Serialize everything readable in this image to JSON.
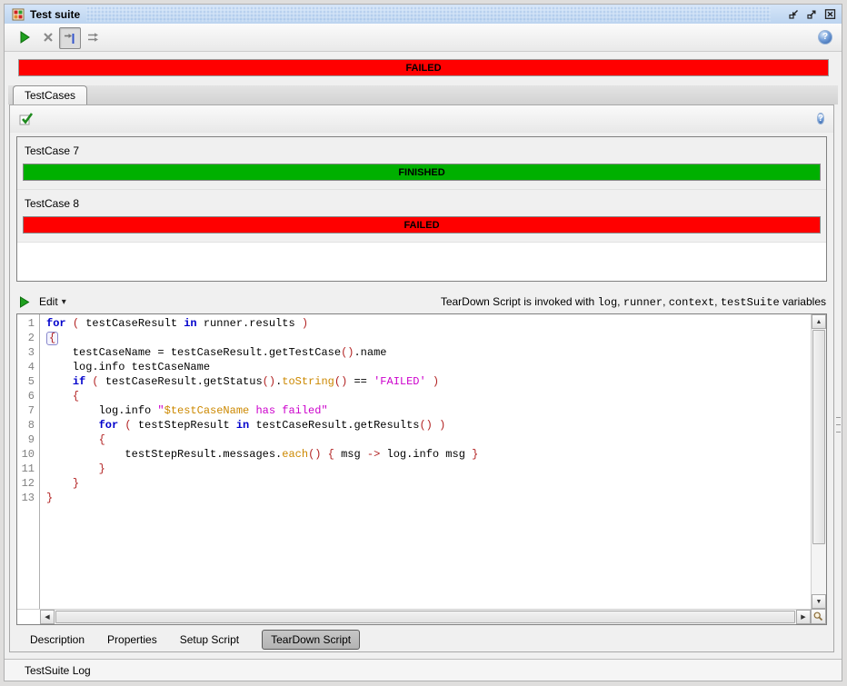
{
  "window": {
    "title": "Test suite"
  },
  "colors": {
    "titlebar": "#c3d9f4",
    "failed": "#ff0000",
    "finished": "#00b000"
  },
  "toolbar": {
    "icons": [
      "run-icon",
      "cancel-icon",
      "run-sequential-toggle-icon",
      "run-options-icon",
      "help-icon"
    ]
  },
  "status": {
    "label": "FAILED",
    "color": "#ff0000"
  },
  "tabs": {
    "label": "TestCases"
  },
  "testcases_toolbar": {
    "icons": [
      "create-testcase-icon",
      "help-icon"
    ]
  },
  "testcases": [
    {
      "name": "TestCase 7",
      "status": "FINISHED",
      "color": "#00b000"
    },
    {
      "name": "TestCase 8",
      "status": "FAILED",
      "color": "#ff0000"
    }
  ],
  "editor_header": {
    "edit_label": "Edit",
    "info_prefix": "TearDown Script is invoked with ",
    "info_vars": [
      "log",
      "runner",
      "context",
      "testSuite"
    ],
    "info_suffix": " variables"
  },
  "code": {
    "lines": [
      {
        "n": 1,
        "toks": [
          [
            "k",
            "for"
          ],
          [
            "d",
            " "
          ],
          [
            "p",
            "("
          ],
          [
            "d",
            " testCaseResult "
          ],
          [
            "k",
            "in"
          ],
          [
            "d",
            " runner.results "
          ],
          [
            "p",
            ")"
          ]
        ]
      },
      {
        "n": 2,
        "toks": [
          [
            "b",
            "{"
          ]
        ]
      },
      {
        "n": 3,
        "toks": [
          [
            "d",
            "    testCaseName = testCaseResult.getTestCase"
          ],
          [
            "p",
            "()"
          ],
          [
            "d",
            ".name"
          ]
        ]
      },
      {
        "n": 4,
        "toks": [
          [
            "d",
            "    log.info testCaseName"
          ]
        ]
      },
      {
        "n": 5,
        "toks": [
          [
            "d",
            "    "
          ],
          [
            "k",
            "if"
          ],
          [
            "d",
            " "
          ],
          [
            "p",
            "("
          ],
          [
            "d",
            " testCaseResult.getStatus"
          ],
          [
            "p",
            "()"
          ],
          [
            "d",
            "."
          ],
          [
            "m",
            "toString"
          ],
          [
            "p",
            "()"
          ],
          [
            "d",
            " == "
          ],
          [
            "s",
            "'FAILED'"
          ],
          [
            "d",
            " "
          ],
          [
            "p",
            ")"
          ]
        ]
      },
      {
        "n": 6,
        "toks": [
          [
            "d",
            "    "
          ],
          [
            "p",
            "{"
          ]
        ]
      },
      {
        "n": 7,
        "toks": [
          [
            "d",
            "        log.info "
          ],
          [
            "s",
            "\""
          ],
          [
            "v",
            "$testCaseName"
          ],
          [
            "s",
            " has failed\""
          ]
        ]
      },
      {
        "n": 8,
        "toks": [
          [
            "d",
            "        "
          ],
          [
            "k",
            "for"
          ],
          [
            "d",
            " "
          ],
          [
            "p",
            "("
          ],
          [
            "d",
            " testStepResult "
          ],
          [
            "k",
            "in"
          ],
          [
            "d",
            " testCaseResult.getResults"
          ],
          [
            "p",
            "()"
          ],
          [
            "d",
            " "
          ],
          [
            "p",
            ")"
          ]
        ]
      },
      {
        "n": 9,
        "toks": [
          [
            "d",
            "        "
          ],
          [
            "p",
            "{"
          ]
        ]
      },
      {
        "n": 10,
        "toks": [
          [
            "d",
            "            testStepResult.messages."
          ],
          [
            "m",
            "each"
          ],
          [
            "p",
            "()"
          ],
          [
            "d",
            " "
          ],
          [
            "p",
            "{"
          ],
          [
            "d",
            " msg "
          ],
          [
            "p",
            "->"
          ],
          [
            "d",
            " log.info msg "
          ],
          [
            "p",
            "}"
          ]
        ]
      },
      {
        "n": 11,
        "toks": [
          [
            "d",
            "        "
          ],
          [
            "p",
            "}"
          ]
        ]
      },
      {
        "n": 12,
        "toks": [
          [
            "d",
            "    "
          ],
          [
            "p",
            "}"
          ]
        ]
      },
      {
        "n": 13,
        "toks": [
          [
            "p",
            "}"
          ]
        ]
      }
    ]
  },
  "bottom_tabs": [
    {
      "label": "Description",
      "selected": false
    },
    {
      "label": "Properties",
      "selected": false
    },
    {
      "label": "Setup Script",
      "selected": false
    },
    {
      "label": "TearDown Script",
      "selected": true
    }
  ],
  "log_bar": {
    "label": "TestSuite Log"
  },
  "glyphs": {
    "help": "?",
    "chevron_down": "▾",
    "scroll_up": "▲",
    "scroll_down": "▼",
    "scroll_left": "◀",
    "scroll_right": "▶"
  }
}
